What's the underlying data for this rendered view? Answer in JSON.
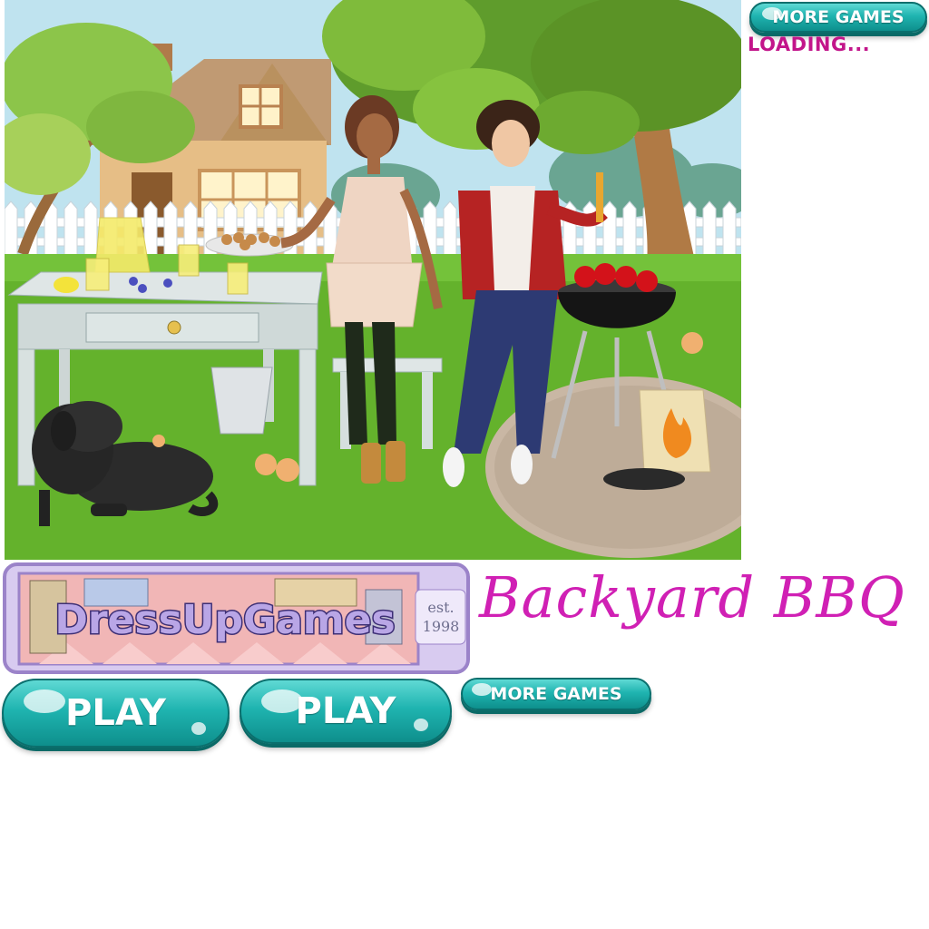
{
  "header": {
    "more_games_label": "MORE GAMES",
    "loading_text": "LOADING..."
  },
  "logo": {
    "brand_text": "DressUpGames",
    "established_line1": "est.",
    "established_line2": "1998"
  },
  "game": {
    "title": "Backyard BBQ"
  },
  "buttons": {
    "play_1": "PLAY",
    "play_2": "PLAY",
    "more_games": "MORE GAMES"
  },
  "colors": {
    "button_teal": "#1fb4b0",
    "title_magenta": "#d020b4",
    "loading_magenta": "#c2158a",
    "logo_purple": "#9b83c9"
  }
}
